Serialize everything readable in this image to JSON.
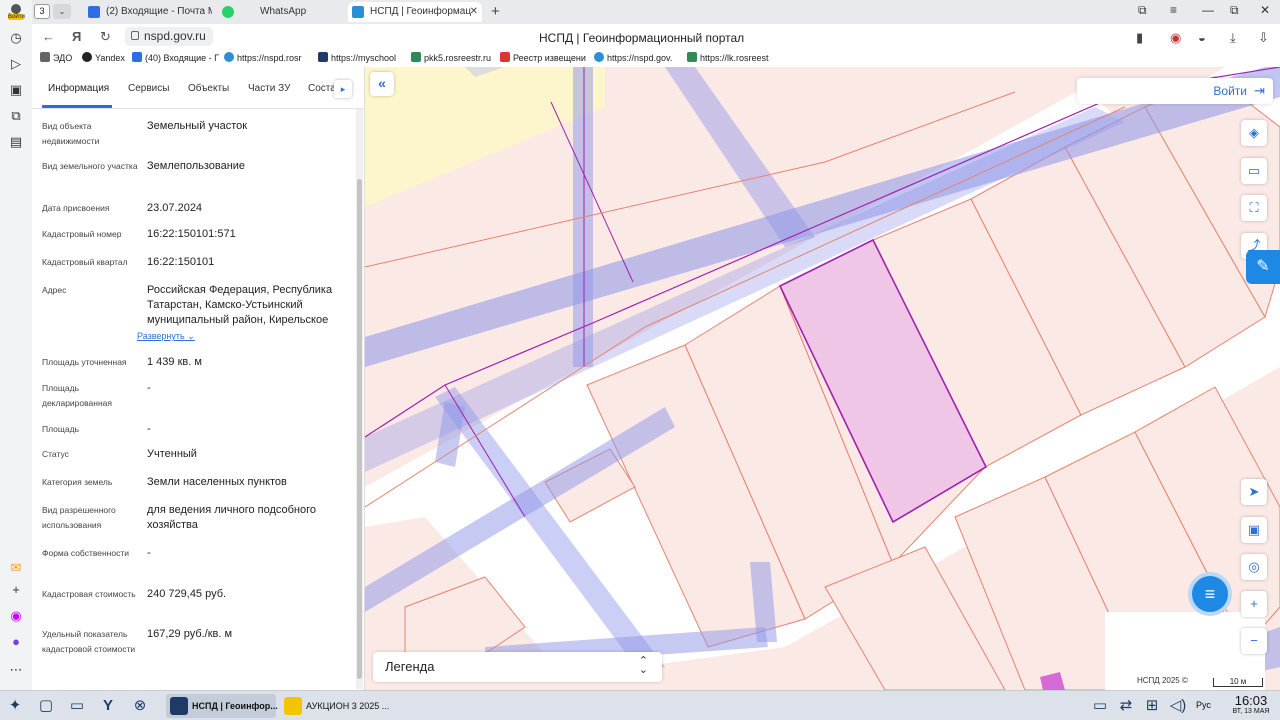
{
  "browser": {
    "tab_count": "3",
    "tabs": [
      {
        "title": "(2) Входящие - Почта Ма",
        "icon": "mail-icon",
        "color": "#2f6ee0"
      },
      {
        "title": "WhatsApp",
        "icon": "whatsapp-icon",
        "color": "#25d366"
      },
      {
        "title": "НСПД | Геоинформац",
        "icon": "nspd-icon",
        "color": "#2c8fd6"
      }
    ],
    "url": "nspd.gov.ru",
    "page_title": "НСПД | Геоинформационный портал",
    "bookmarks": [
      {
        "label": "ЭДО",
        "color": "#666"
      },
      {
        "label": "Yandex",
        "color": "#222"
      },
      {
        "label": "(40) Входящие - Г",
        "color": "#2f6ee0"
      },
      {
        "label": "https://nspd.rosr",
        "color": "#2c8fd6"
      },
      {
        "label": "https://myschool",
        "color": "#1d3b66"
      },
      {
        "label": "pkk5.rosreestr.ru",
        "color": "#2e8b57"
      },
      {
        "label": "Реестр извещени",
        "color": "#d33"
      },
      {
        "label": "https://nspd.gov.",
        "color": "#2c8fd6"
      },
      {
        "label": "https://lk.rosreest",
        "color": "#2e8b57"
      }
    ]
  },
  "os_sidebar": {
    "avatar_label": "Войти"
  },
  "panel": {
    "tabs": [
      "Информация",
      "Сервисы",
      "Объекты",
      "Части ЗУ",
      "Соста"
    ],
    "fields": [
      {
        "label": "Вид объекта недвижимости",
        "value": "Земельный участок"
      },
      {
        "label": "Вид земельного участка",
        "value": "Землепользование"
      },
      {
        "label": "Дата присвоения",
        "value": "23.07.2024"
      },
      {
        "label": "Кадастровый номер",
        "value": "16:22:150101:571"
      },
      {
        "label": "Кадастровый квартал",
        "value": "16:22:150101"
      },
      {
        "label": "Адрес",
        "value": "Российская Федерация, Республика Татарстан, Камско-Устьинский муниципальный район, Кирельское"
      },
      {
        "label": "Площадь уточненная",
        "value": "1 439 кв. м"
      },
      {
        "label": "Площадь декларированная",
        "value": "-"
      },
      {
        "label": "Площадь",
        "value": "-"
      },
      {
        "label": "Статус",
        "value": "Учтенный"
      },
      {
        "label": "Категория земель",
        "value": "Земли населенных пунктов"
      },
      {
        "label": "Вид разрешенного использования",
        "value": "для ведения личного подсобного хозяйства"
      },
      {
        "label": "Форма собственности",
        "value": "-"
      },
      {
        "label": "Кадастровая стоимость",
        "value": "240 729,45 руб."
      },
      {
        "label": "Удельный показатель кадастровой стоимости",
        "value": "167,29 руб./кв. м"
      }
    ],
    "expand_label": "Развернуть"
  },
  "map": {
    "login_label": "Войти",
    "legend_label": "Легенда",
    "copyright": "НСПД 2025 ©",
    "scale": "10 м",
    "colors": {
      "parcel_fill": "#fbe9e6",
      "parcel_line": "#e8826e",
      "zone_band": "#8e95e8",
      "selected_fill": "#f0c6e6",
      "selected_line": "#a020b0",
      "accent": "#2c6fd6"
    }
  },
  "taskbar": {
    "tasks": [
      {
        "label": "НСПД | Геоинфор...",
        "active": true
      },
      {
        "label": "АУКЦИОН 3 2025 ...",
        "active": false
      }
    ],
    "lang": "Рус",
    "time": "16:03",
    "date": "ВТ, 13 МАЯ"
  }
}
